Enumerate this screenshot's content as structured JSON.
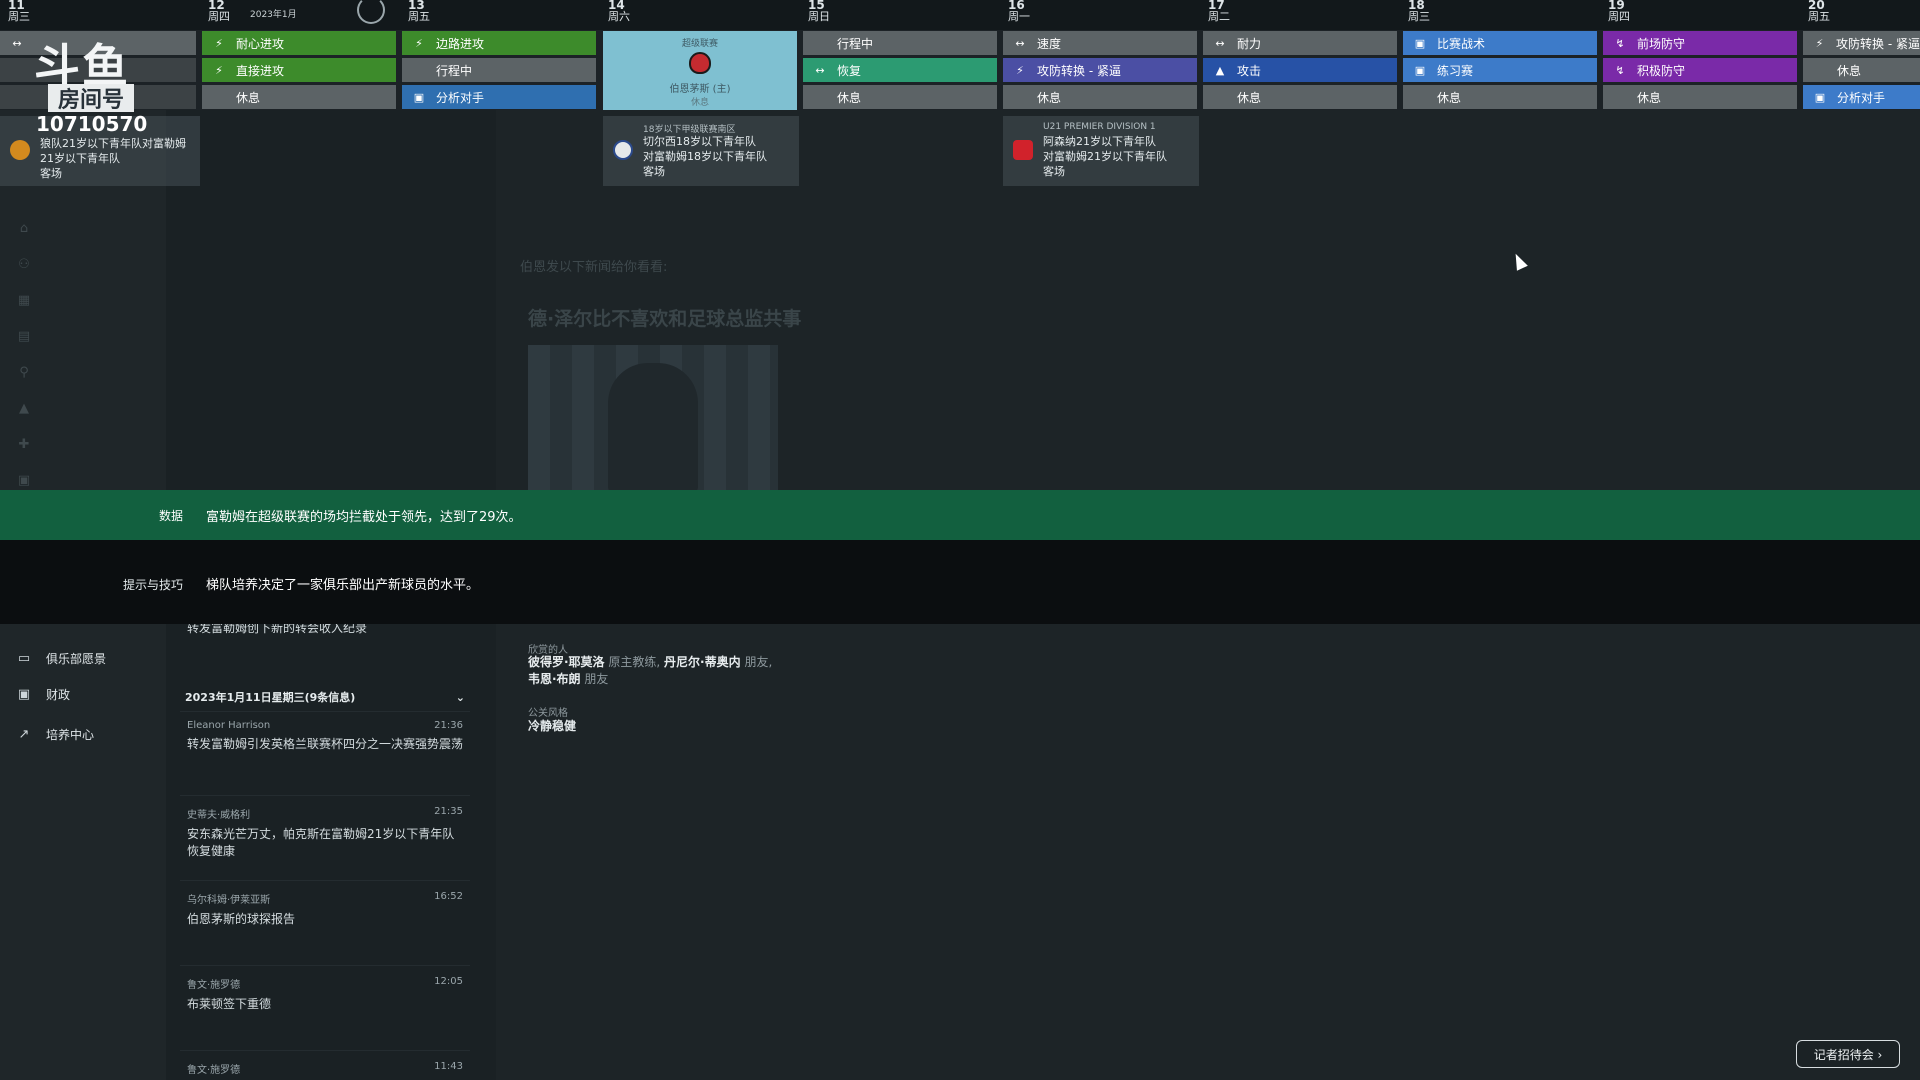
{
  "overlay": {
    "logo_text": "斗鱼",
    "room_label": "房间号",
    "room_number": "10710570"
  },
  "calendar": {
    "month": "2023年1月",
    "days": [
      {
        "num": "11",
        "weekday": "周三"
      },
      {
        "num": "12",
        "weekday": "周四"
      },
      {
        "num": "13",
        "weekday": "周五"
      },
      {
        "num": "14",
        "weekday": "周六"
      },
      {
        "num": "15",
        "weekday": "周日"
      },
      {
        "num": "16",
        "weekday": "周一"
      },
      {
        "num": "17",
        "weekday": "周二"
      },
      {
        "num": "18",
        "weekday": "周三"
      },
      {
        "num": "19",
        "weekday": "周四"
      },
      {
        "num": "20",
        "weekday": "周五"
      }
    ],
    "slots": {
      "d12": [
        "耐心进攻",
        "直接进攻",
        "休息"
      ],
      "d13": [
        "边路进攻",
        "行程中",
        "分析对手"
      ],
      "d15": [
        "行程中",
        "恢复",
        "休息"
      ],
      "d16": [
        "速度",
        "攻防转换 - 紧逼",
        "休息"
      ],
      "d17": [
        "耐力",
        "攻击",
        "休息"
      ],
      "d18": [
        "比赛战术",
        "练习赛",
        "休息"
      ],
      "d19": [
        "前场防守",
        "积极防守",
        "休息"
      ],
      "d20": [
        "攻防转换 - 紧逼",
        "休息",
        "分析对手"
      ]
    },
    "match": {
      "competition": "超级联赛",
      "opponent": "伯恩茅斯 (主)",
      "note": "休息"
    },
    "fixtures": [
      {
        "league": "",
        "line1": "狼队21岁以下青年队对富勒姆",
        "line2": "21岁以下青年队",
        "line3": "客场"
      },
      {
        "league": "18岁以下甲级联赛南区",
        "line1": "切尔西18岁以下青年队",
        "line2": "对富勒姆18岁以下青年队",
        "line3": "客场"
      },
      {
        "league": "U21 PREMIER DIVISION 1",
        "line1": "阿森纳21岁以下青年队",
        "line2": "对富勒姆21岁以下青年队",
        "line3": "客场"
      }
    ]
  },
  "sidebar": {
    "items": [
      {
        "label": "俱乐部愿景"
      },
      {
        "label": "财政"
      },
      {
        "label": "培养中心"
      }
    ]
  },
  "feed": {
    "partial_subject": "转发富勒姆创下新的转会收入纪录",
    "date_header": "2023年1月11日星期三(9条信息)",
    "messages": [
      {
        "from": "Eleanor Harrison",
        "time": "21:36",
        "subject": "转发富勒姆引发英格兰联赛杯四分之一决赛强势震荡"
      },
      {
        "from": "史蒂夫·威格利",
        "time": "21:35",
        "subject": "安东森光芒万丈，帕克斯在富勒姆21岁以下青年队恢复健康"
      },
      {
        "from": "乌尔科姆·伊莱亚斯",
        "time": "16:52",
        "subject": "伯恩茅斯的球探报告"
      },
      {
        "from": "鲁文·施罗德",
        "time": "12:05",
        "subject": "布莱顿签下重德"
      },
      {
        "from": "鲁文·施罗德",
        "time": "11:43",
        "subject": ""
      }
    ]
  },
  "article": {
    "headline": "德·泽尔比不喜欢和足球总监共事",
    "intro": "伯恩发以下新闻给你看看:",
    "admirers_label": "欣赏的人",
    "admirers": [
      {
        "name": "彼得罗·耶莫洛",
        "role": "原主教练"
      },
      {
        "name": "丹尼尔·蒂奥内",
        "role": "朋友"
      },
      {
        "name": "韦恩·布朗",
        "role": "朋友"
      }
    ],
    "style_label": "公关风格",
    "style_value": "冷静稳健",
    "press_button": "记者招待会 ›"
  },
  "banners": {
    "stat_label": "数据",
    "stat_text": "富勒姆在超级联赛的场均拦截处于领先，达到了29次。",
    "tip_label": "提示与技巧",
    "tip_text": "梯队培养决定了一家俱乐部出产新球员的水平。"
  }
}
